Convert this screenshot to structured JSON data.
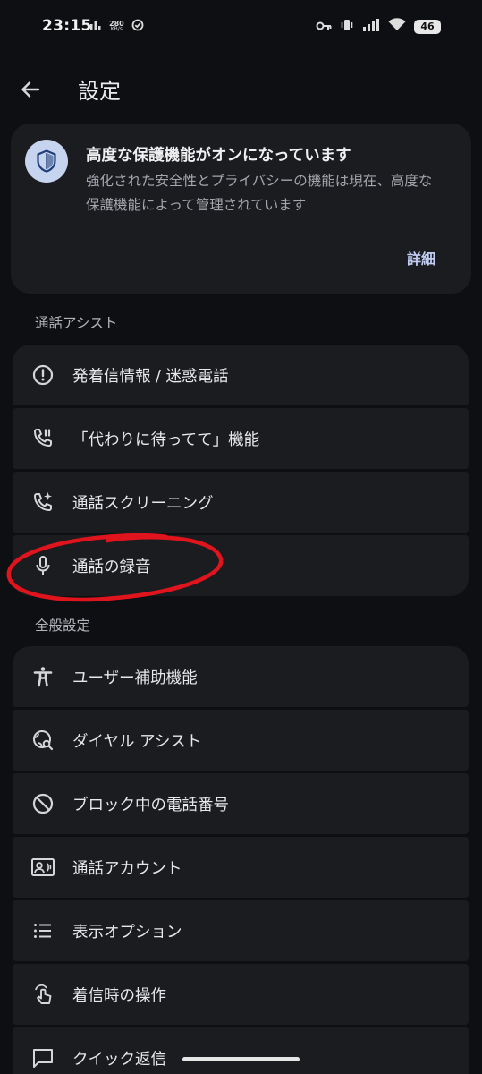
{
  "status_bar": {
    "time": "23:15",
    "net_speed": "280",
    "net_unit": "KB/s",
    "battery": "46"
  },
  "app_bar": {
    "title": "設定",
    "back_icon": "arrow-back-icon"
  },
  "protection_card": {
    "icon": "shield-icon",
    "title": "高度な保護機能がオンになっています",
    "description": "強化された安全性とプライバシーの機能は現在、高度な保護機能によって管理されています",
    "details_label": "詳細"
  },
  "sections": [
    {
      "header": "通話アシスト",
      "items": [
        {
          "label": "発着信情報 / 迷惑電話",
          "icon": "alert-circle-icon"
        },
        {
          "label": "「代わりに待ってて」機能",
          "icon": "phone-hold-icon"
        },
        {
          "label": "通話スクリーニング",
          "icon": "phone-sparkle-icon"
        },
        {
          "label": "通話の録音",
          "icon": "microphone-icon"
        }
      ]
    },
    {
      "header": "全般設定",
      "items": [
        {
          "label": "ユーザー補助機能",
          "icon": "accessibility-icon"
        },
        {
          "label": "ダイヤル アシスト",
          "icon": "globe-search-icon"
        },
        {
          "label": "ブロック中の電話番号",
          "icon": "block-icon"
        },
        {
          "label": "通話アカウント",
          "icon": "contact-card-icon"
        },
        {
          "label": "表示オプション",
          "icon": "list-icon"
        },
        {
          "label": "着信時の操作",
          "icon": "gesture-tap-icon"
        },
        {
          "label": "クイック返信",
          "icon": "message-icon"
        }
      ]
    }
  ],
  "colors": {
    "background": "#0e0f12",
    "card": "#1b1c20",
    "accent": "#c1cdf2",
    "annotation_red": "#e0141c"
  }
}
